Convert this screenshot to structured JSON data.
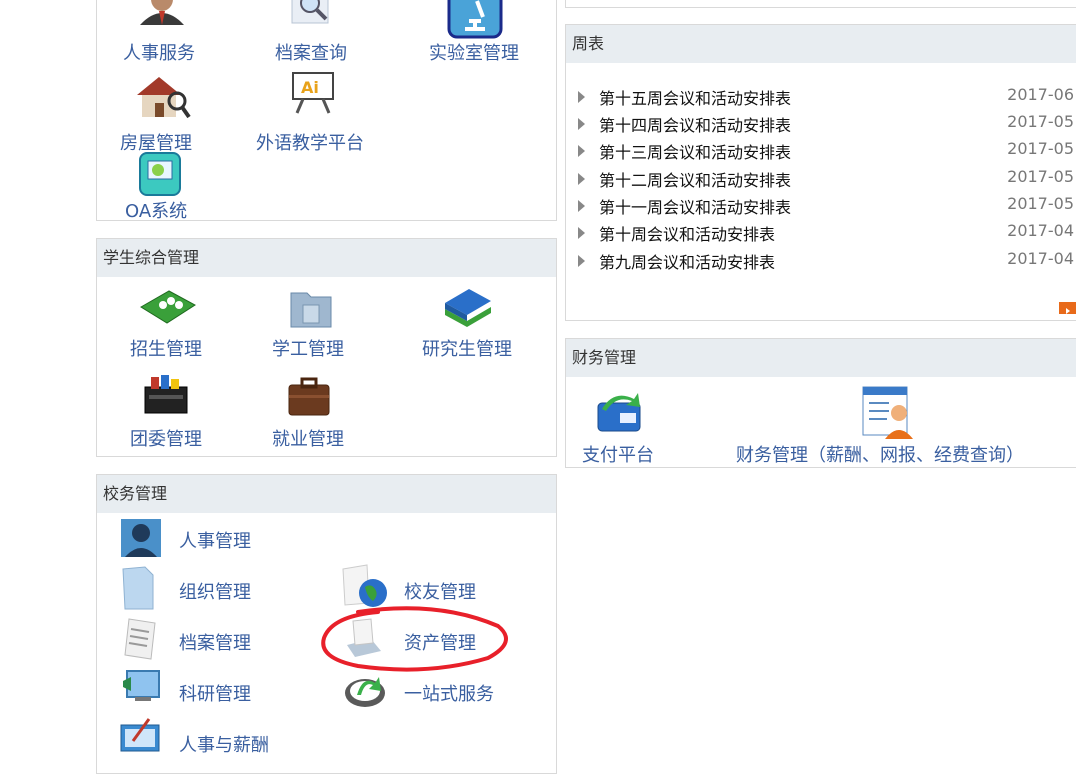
{
  "top_panel": {
    "apps": [
      {
        "label": "人事服务",
        "icon": "person-user-icon"
      },
      {
        "label": "档案查询",
        "icon": "magnifier-icon"
      },
      {
        "label": "实验室管理",
        "icon": "microscope-icon"
      },
      {
        "label": "房屋管理",
        "icon": "house-search-icon"
      },
      {
        "label": "外语教学平台",
        "icon": "language-board-icon"
      },
      {
        "label": "OA系统",
        "icon": "oa-system-icon"
      }
    ]
  },
  "student_panel": {
    "title": "学生综合管理",
    "apps": [
      {
        "label": "招生管理",
        "icon": "enrollment-icon"
      },
      {
        "label": "学工管理",
        "icon": "folder-icon"
      },
      {
        "label": "研究生管理",
        "icon": "books-icon"
      },
      {
        "label": "团委管理",
        "icon": "toolbox-icon"
      },
      {
        "label": "就业管理",
        "icon": "briefcase-icon"
      }
    ]
  },
  "school_panel": {
    "title": "校务管理",
    "items": [
      {
        "label": "人事管理",
        "icon": "personnel-icon"
      },
      {
        "label": "组织管理",
        "icon": "document-icon"
      },
      {
        "label": "校友管理",
        "icon": "globe-icon"
      },
      {
        "label": "档案管理",
        "icon": "archive-icon"
      },
      {
        "label": "资产管理",
        "icon": "asset-icon"
      },
      {
        "label": "科研管理",
        "icon": "monitor-icon"
      },
      {
        "label": "一站式服务",
        "icon": "refresh-icon"
      },
      {
        "label": "人事与薪酬",
        "icon": "pen-tablet-icon"
      }
    ]
  },
  "weekly_panel": {
    "title": "周表",
    "items": [
      {
        "title": "第十五周会议和活动安排表",
        "date": "2017-06"
      },
      {
        "title": "第十四周会议和活动安排表",
        "date": "2017-05"
      },
      {
        "title": "第十三周会议和活动安排表",
        "date": "2017-05"
      },
      {
        "title": "第十二周会议和活动安排表",
        "date": "2017-05"
      },
      {
        "title": "第十一周会议和活动安排表",
        "date": "2017-05"
      },
      {
        "title": "第十周会议和活动安排表",
        "date": "2017-04"
      },
      {
        "title": "第九周会议和活动安排表",
        "date": "2017-04"
      }
    ],
    "more_icon": "more-arrow-icon"
  },
  "finance_panel": {
    "title": "财务管理",
    "apps": [
      {
        "label": "支付平台",
        "icon": "payment-icon"
      },
      {
        "label": "财务管理（薪酬、网报、经费查询）",
        "icon": "finance-person-icon"
      }
    ]
  },
  "annotation": {
    "color": "#e8202a",
    "target": "资产管理"
  },
  "colors": {
    "link": "#3a5fa0",
    "header_bg": "#e8edf1",
    "border": "#d9d9d9"
  }
}
